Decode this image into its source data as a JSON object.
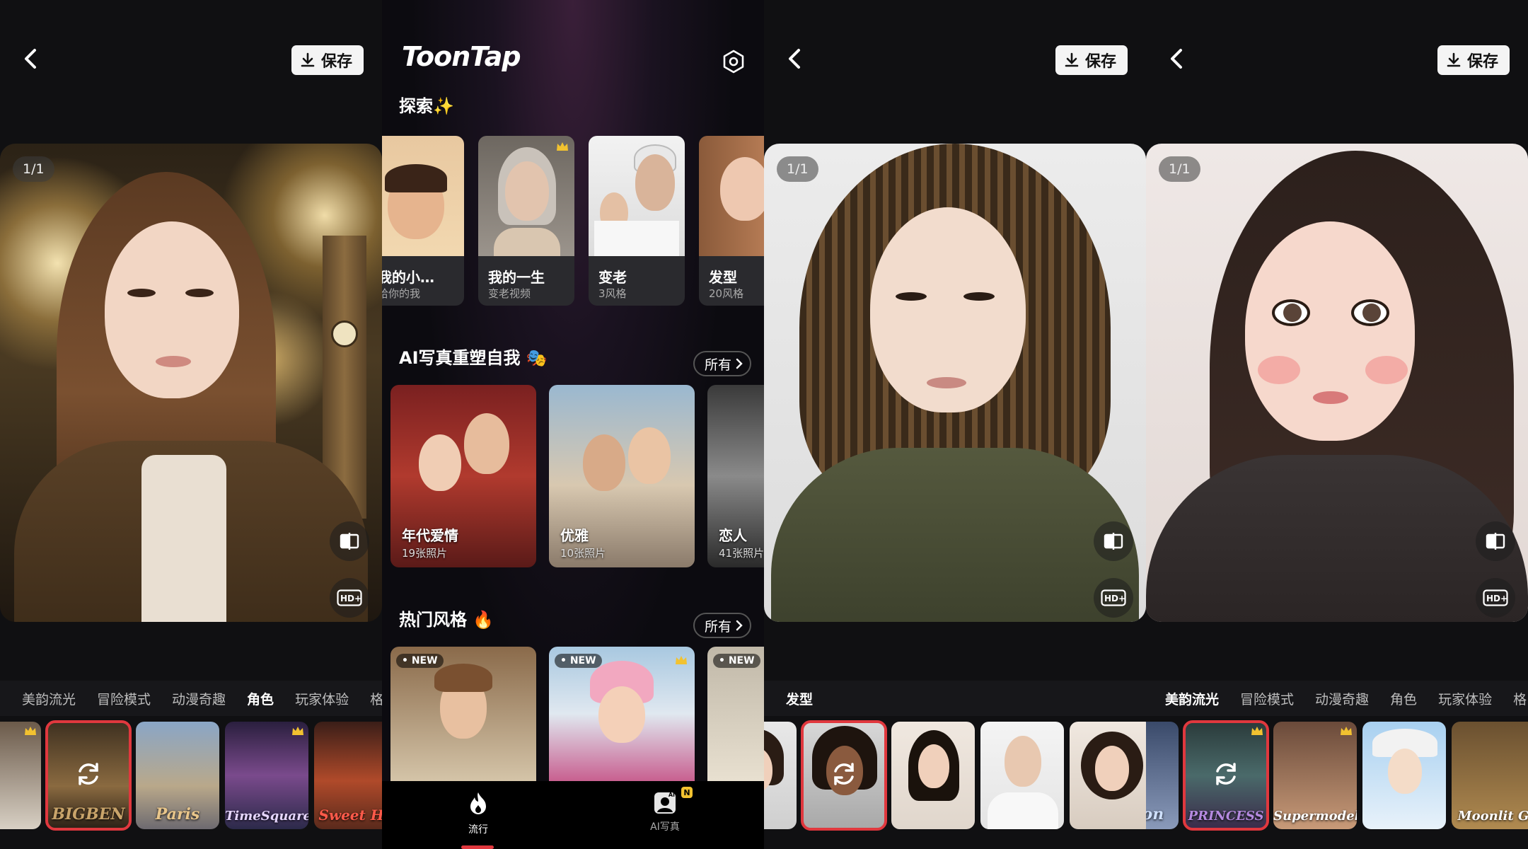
{
  "editor": {
    "save_label": "保存",
    "counter": "1/1"
  },
  "panel1": {
    "categories": [
      {
        "label": "美韵流光",
        "active": false
      },
      {
        "label": "冒险模式",
        "active": false
      },
      {
        "label": "动漫奇趣",
        "active": false
      },
      {
        "label": "角色",
        "active": true
      },
      {
        "label": "玩家体验",
        "active": false
      },
      {
        "label": "格",
        "active": false
      }
    ],
    "thumbs": [
      "",
      "BIGBEN",
      "Paris",
      "TimeSquare",
      "Sweet Ha"
    ]
  },
  "app": {
    "logo": "ToonTap",
    "explore_title": "探索✨",
    "explore": [
      {
        "title": "我的小…",
        "sub": "给你的我"
      },
      {
        "title": "我的一生",
        "sub": "变老视频"
      },
      {
        "title": "变老",
        "sub": "3风格"
      },
      {
        "title": "发型",
        "sub": "20风格"
      }
    ],
    "ai_title": "AI写真重塑自我 🎭",
    "all_label": "所有",
    "ai_cards": [
      {
        "title": "年代爱情",
        "sub": "19张照片"
      },
      {
        "title": "优雅",
        "sub": "10张照片"
      },
      {
        "title": "恋人",
        "sub": "41张照片"
      }
    ],
    "hot_title": "热门风格 🔥",
    "new_badge": "• NEW",
    "nav": {
      "trend": "流行",
      "ai_photo": "AI写真",
      "ai_badge": "N",
      "ai_icon_text": "AI"
    }
  },
  "panel3": {
    "category": "发型"
  },
  "panel4": {
    "categories": [
      {
        "label": "美韵流光",
        "active": true
      },
      {
        "label": "冒险模式",
        "active": false
      },
      {
        "label": "动漫奇趣",
        "active": false
      },
      {
        "label": "角色",
        "active": false
      },
      {
        "label": "玩家体验",
        "active": false
      },
      {
        "label": "格",
        "active": false
      }
    ],
    "thumbs": [
      "Vision",
      "PRINCESS",
      "Supermodel",
      "",
      "Moonlit G"
    ]
  }
}
